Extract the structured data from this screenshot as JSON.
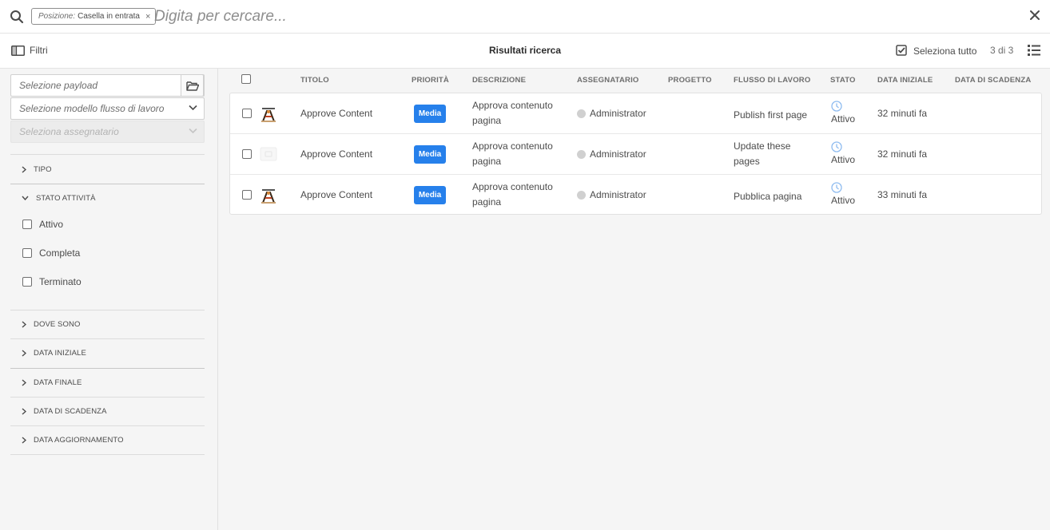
{
  "search": {
    "tag_key": "Posizione:",
    "tag_value": "Casella in entrata",
    "tag_close": "×",
    "placeholder": "Digita per cercare...",
    "close": "×"
  },
  "toolbar": {
    "filters_label": "Filtri",
    "title": "Risultati ricerca",
    "select_all_label": "Seleziona tutto",
    "count": "3 di 3"
  },
  "sidebar": {
    "payload_placeholder": "Selezione payload",
    "model_placeholder": "Selezione modello flusso di lavoro",
    "assignee_placeholder": "Seleziona assegnatario",
    "sections": {
      "tipo": "TIPO",
      "stato_attivita": "STATO ATTIVITÀ",
      "dove_sono": "DOVE SONO",
      "data_iniziale": "DATA INIZIALE",
      "data_finale": "DATA FINALE",
      "data_scadenza": "DATA DI SCADENZA",
      "data_aggiornamento": "DATA AGGIORNAMENTO"
    },
    "status_options": [
      "Attivo",
      "Completa",
      "Terminato"
    ]
  },
  "table": {
    "headers": {
      "titolo": "TITOLO",
      "priorita": "PRIORITÀ",
      "descrizione": "DESCRIZIONE",
      "assegnatario": "ASSEGNATARIO",
      "progetto": "PROGETTO",
      "flusso": "FLUSSO DI LAVORO",
      "stato": "STATO",
      "data_iniziale": "DATA INIZIALE",
      "data_scadenza": "DATA DI SCADENZA"
    },
    "rows": [
      {
        "title": "Approve Content",
        "priority": "Media",
        "description": "Approva contenuto pagina",
        "assignee": "Administrator",
        "project": "",
        "workflow": "Publish first page",
        "status": "Attivo",
        "start": "32 minuti fa",
        "due": ""
      },
      {
        "title": "Approve Content",
        "priority": "Media",
        "description": "Approva contenuto pagina",
        "assignee": "Administrator",
        "project": "",
        "workflow": "Update these pages",
        "status": "Attivo",
        "start": "32 minuti fa",
        "due": ""
      },
      {
        "title": "Approve Content",
        "priority": "Media",
        "description": "Approva contenuto pagina",
        "assignee": "Administrator",
        "project": "",
        "workflow": "Pubblica pagina",
        "status": "Attivo",
        "start": "33 minuti fa",
        "due": ""
      }
    ]
  },
  "colors": {
    "accent": "#2680eb",
    "clock": "#8fbcf0"
  }
}
